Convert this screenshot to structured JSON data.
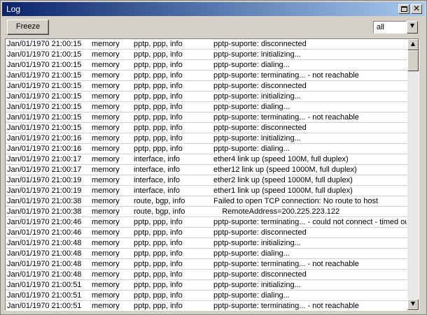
{
  "window": {
    "title": "Log",
    "maximize_icon": "maximize-icon",
    "close_icon": "close-icon",
    "close_glyph": "✕"
  },
  "toolbar": {
    "freeze_label": "Freeze",
    "filter": {
      "value": "all",
      "arrow_glyph": "▼"
    }
  },
  "scrollbar": {
    "up_glyph": "▲",
    "down_glyph": "▼"
  },
  "log": [
    [
      "Jan/01/1970 21:00:15",
      "memory",
      "pptp, ppp, info",
      "pptp-suporte: disconnected"
    ],
    [
      "Jan/01/1970 21:00:15",
      "memory",
      "pptp, ppp, info",
      "pptp-suporte: initializing..."
    ],
    [
      "Jan/01/1970 21:00:15",
      "memory",
      "pptp, ppp, info",
      "pptp-suporte: dialing..."
    ],
    [
      "Jan/01/1970 21:00:15",
      "memory",
      "pptp, ppp, info",
      "pptp-suporte: terminating... - not reachable"
    ],
    [
      "Jan/01/1970 21:00:15",
      "memory",
      "pptp, ppp, info",
      "pptp-suporte: disconnected"
    ],
    [
      "Jan/01/1970 21:00:15",
      "memory",
      "pptp, ppp, info",
      "pptp-suporte: initializing..."
    ],
    [
      "Jan/01/1970 21:00:15",
      "memory",
      "pptp, ppp, info",
      "pptp-suporte: dialing..."
    ],
    [
      "Jan/01/1970 21:00:15",
      "memory",
      "pptp, ppp, info",
      "pptp-suporte: terminating... - not reachable"
    ],
    [
      "Jan/01/1970 21:00:15",
      "memory",
      "pptp, ppp, info",
      "pptp-suporte: disconnected"
    ],
    [
      "Jan/01/1970 21:00:16",
      "memory",
      "pptp, ppp, info",
      "pptp-suporte: initializing..."
    ],
    [
      "Jan/01/1970 21:00:16",
      "memory",
      "pptp, ppp, info",
      "pptp-suporte: dialing..."
    ],
    [
      "Jan/01/1970 21:00:17",
      "memory",
      "interface, info",
      "ether4 link up (speed 100M, full duplex)"
    ],
    [
      "Jan/01/1970 21:00:17",
      "memory",
      "interface, info",
      "ether12 link up (speed 1000M, full duplex)"
    ],
    [
      "Jan/01/1970 21:00:19",
      "memory",
      "interface, info",
      "ether2 link up (speed 1000M, full duplex)"
    ],
    [
      "Jan/01/1970 21:00:19",
      "memory",
      "interface, info",
      "ether1 link up (speed 1000M, full duplex)"
    ],
    [
      "Jan/01/1970 21:00:38",
      "memory",
      "route, bgp, info",
      "Failed to open TCP connection: No route to host"
    ],
    [
      "Jan/01/1970 21:00:38",
      "memory",
      "route, bgp, info",
      "    RemoteAddress=200.225.223.122"
    ],
    [
      "Jan/01/1970 21:00:46",
      "memory",
      "pptp, ppp, info",
      "pptp-suporte: terminating... - could not connect - timed out"
    ],
    [
      "Jan/01/1970 21:00:46",
      "memory",
      "pptp, ppp, info",
      "pptp-suporte: disconnected"
    ],
    [
      "Jan/01/1970 21:00:48",
      "memory",
      "pptp, ppp, info",
      "pptp-suporte: initializing..."
    ],
    [
      "Jan/01/1970 21:00:48",
      "memory",
      "pptp, ppp, info",
      "pptp-suporte: dialing..."
    ],
    [
      "Jan/01/1970 21:00:48",
      "memory",
      "pptp, ppp, info",
      "pptp-suporte: terminating... - not reachable"
    ],
    [
      "Jan/01/1970 21:00:48",
      "memory",
      "pptp, ppp, info",
      "pptp-suporte: disconnected"
    ],
    [
      "Jan/01/1970 21:00:51",
      "memory",
      "pptp, ppp, info",
      "pptp-suporte: initializing..."
    ],
    [
      "Jan/01/1970 21:00:51",
      "memory",
      "pptp, ppp, info",
      "pptp-suporte: dialing..."
    ],
    [
      "Jan/01/1970 21:00:51",
      "memory",
      "pptp, ppp, info",
      "pptp-suporte: terminating... - not reachable"
    ]
  ]
}
